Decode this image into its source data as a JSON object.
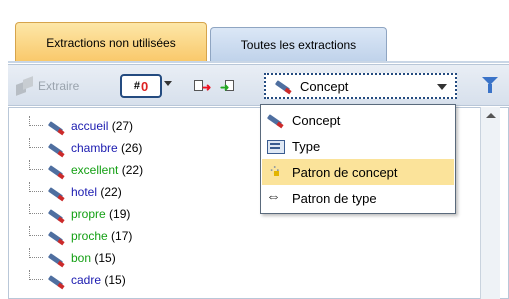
{
  "tabs": {
    "active_label": "Extractions non utilisées",
    "inactive_label": "Toutes les extractions"
  },
  "toolbar": {
    "extract_label": "Extraire",
    "filter_count_label": "#",
    "filter_count_digit": "0",
    "type_select_value": "Concept"
  },
  "dropdown": {
    "options": [
      {
        "label": "Concept",
        "icon": "concept-icon"
      },
      {
        "label": "Type",
        "icon": "type-icon"
      },
      {
        "label": "Patron de concept",
        "icon": "concept-pattern-icon",
        "selected": true
      },
      {
        "label": "Patron de type",
        "icon": "type-pattern-icon"
      }
    ]
  },
  "colors": {
    "concept_blue": "#1b1bb0",
    "concept_green": "#14a014",
    "selection_yellow": "#fbe39a"
  },
  "tree": {
    "items": [
      {
        "name": "accueil",
        "count": "(27)",
        "color": "blue"
      },
      {
        "name": "chambre",
        "count": "(26)",
        "color": "blue"
      },
      {
        "name": "excellent",
        "count": "(22)",
        "color": "green"
      },
      {
        "name": "hotel",
        "count": "(22)",
        "color": "blue"
      },
      {
        "name": "propre",
        "count": "(19)",
        "color": "green"
      },
      {
        "name": "proche",
        "count": "(17)",
        "color": "green"
      },
      {
        "name": "bon",
        "count": "(15)",
        "color": "green"
      },
      {
        "name": "cadre",
        "count": "(15)",
        "color": "blue"
      }
    ]
  }
}
